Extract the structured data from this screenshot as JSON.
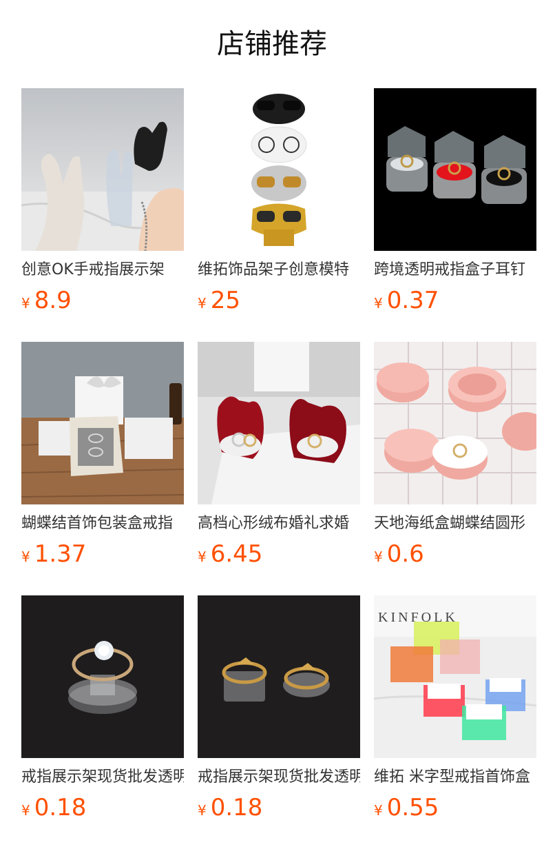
{
  "page": {
    "title": "店铺推荐"
  },
  "products": [
    {
      "title": "创意OK手戒指展示架",
      "currency": "¥",
      "price": "8.9",
      "image": "ok-hand-ring-stand"
    },
    {
      "title": "维拓饰品架子创意模特",
      "currency": "¥",
      "price": "25",
      "image": "glasses-mannequin-heads"
    },
    {
      "title": "跨境透明戒指盒子耳钉",
      "currency": "¥",
      "price": "0.37",
      "image": "clear-acrylic-ring-boxes"
    },
    {
      "title": "蝴蝶结首饰包装盒戒指",
      "currency": "¥",
      "price": "1.37",
      "image": "bow-gift-boxes"
    },
    {
      "title": "高档心形绒布婚礼求婚",
      "currency": "¥",
      "price": "6.45",
      "image": "heart-velvet-ring-boxes"
    },
    {
      "title": "天地海纸盒蝴蝶结圆形",
      "currency": "¥",
      "price": "0.6",
      "image": "pink-round-paper-boxes"
    },
    {
      "title": "戒指展示架现货批发透明",
      "currency": "¥",
      "price": "0.18",
      "image": "round-acrylic-ring-stand"
    },
    {
      "title": "戒指展示架现货批发透明",
      "currency": "¥",
      "price": "0.18",
      "image": "square-acrylic-ring-stands"
    },
    {
      "title": "维拓 米字型戒指首饰盒",
      "currency": "¥",
      "price": "0.55",
      "image": "colorful-square-ring-boxes"
    }
  ]
}
